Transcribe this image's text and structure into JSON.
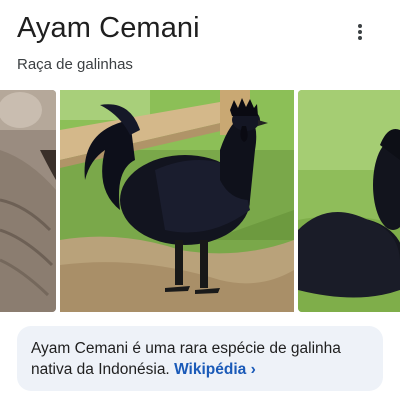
{
  "entity": {
    "title": "Ayam Cemani",
    "subtitle": "Raça de galinhas"
  },
  "menu": {
    "icon": "more-vert-icon"
  },
  "images": [
    {
      "name": "image-1",
      "subject": "cropped animal fur"
    },
    {
      "name": "image-2",
      "subject": "black rooster standing on grass"
    },
    {
      "name": "image-3",
      "subject": "black hens on grass"
    }
  ],
  "description": {
    "text": "Ayam Cemani é uma rara espécie de galinha nativa da Indonésia.",
    "source_label": "Wikipédia",
    "chevron": "›"
  },
  "colors": {
    "title": "#1f1f1f",
    "link": "#1a5ab8",
    "description_bg": "#eef2f8"
  }
}
